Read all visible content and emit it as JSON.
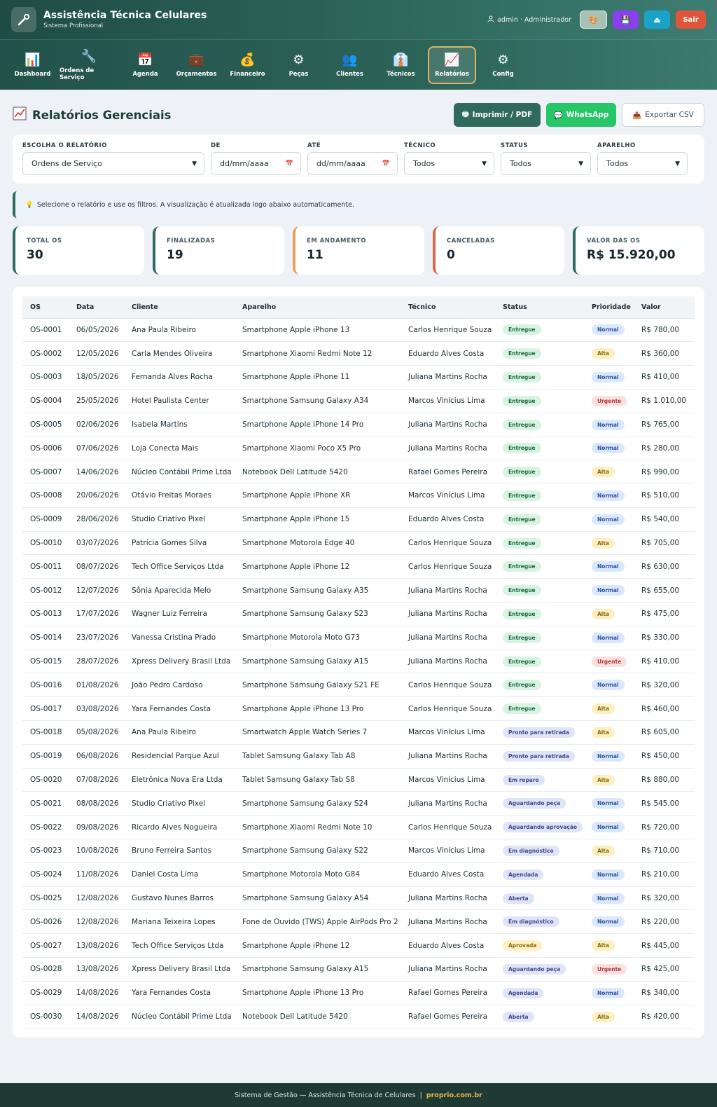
{
  "header": {
    "title": "Assistência Técnica Celulares",
    "subtitle": "Sistema Profissional",
    "user": "admin · Administrador",
    "logout_label": "Sair"
  },
  "nav": [
    {
      "label": "Dashboard",
      "icon": "bar-chart-icon",
      "glyph": "📊"
    },
    {
      "label": "Ordens de Serviço",
      "icon": "wrench-icon",
      "glyph": "🔧"
    },
    {
      "label": "Agenda",
      "icon": "calendar-icon",
      "glyph": "📅"
    },
    {
      "label": "Orçamentos",
      "icon": "briefcase-icon",
      "glyph": "💼"
    },
    {
      "label": "Financeiro",
      "icon": "money-bag-icon",
      "glyph": "💰"
    },
    {
      "label": "Peças",
      "icon": "gear-icon",
      "glyph": "⚙"
    },
    {
      "label": "Clientes",
      "icon": "users-icon",
      "glyph": "👥"
    },
    {
      "label": "Técnicos",
      "icon": "technician-icon",
      "glyph": "👔"
    },
    {
      "label": "Relatórios",
      "icon": "chart-up-icon",
      "glyph": "📈"
    },
    {
      "label": "Config",
      "icon": "settings-icon",
      "glyph": "⚙"
    }
  ],
  "page": {
    "title": "Relatórios Gerenciais",
    "print_label": "Imprimir / PDF",
    "whatsapp_label": "WhatsApp",
    "csv_label": "Exportar CSV"
  },
  "filters": {
    "report_label": "ESCOLHA O RELATÓRIO",
    "report_value": "Ordens de Serviço",
    "from_label": "DE",
    "from_value": "dd/mm/aaaa",
    "to_label": "ATÉ",
    "to_value": "dd/mm/aaaa",
    "tech_label": "TÉCNICO",
    "tech_value": "Todos",
    "status_label": "STATUS",
    "status_value": "Todos",
    "device_label": "APARELHO",
    "device_value": "Todos"
  },
  "hint": "Selecione o relatório e use os filtros. A visualização é atualizada logo abaixo automaticamente.",
  "stats": [
    {
      "label": "TOTAL OS",
      "value": "30"
    },
    {
      "label": "FINALIZADAS",
      "value": "19"
    },
    {
      "label": "EM ANDAMENTO",
      "value": "11"
    },
    {
      "label": "CANCELADAS",
      "value": "0"
    },
    {
      "label": "VALOR DAS OS",
      "value": "R$ 15.920,00"
    }
  ],
  "table": {
    "headers": [
      "OS",
      "Data",
      "Cliente",
      "Aparelho",
      "Técnico",
      "Status",
      "Prioridade",
      "Valor"
    ],
    "rows": [
      [
        "OS-0001",
        "06/05/2026",
        "Ana Paula Ribeiro",
        "Smartphone Apple iPhone 13",
        "Carlos Henrique Souza",
        "Entregue",
        "Normal",
        "R$ 780,00"
      ],
      [
        "OS-0002",
        "12/05/2026",
        "Carla Mendes Oliveira",
        "Smartphone Xiaomi Redmi Note 12",
        "Eduardo Alves Costa",
        "Entregue",
        "Alta",
        "R$ 360,00"
      ],
      [
        "OS-0003",
        "18/05/2026",
        "Fernanda Alves Rocha",
        "Smartphone Apple iPhone 11",
        "Juliana Martins Rocha",
        "Entregue",
        "Normal",
        "R$ 410,00"
      ],
      [
        "OS-0004",
        "25/05/2026",
        "Hotel Paulista Center",
        "Smartphone Samsung Galaxy A34",
        "Marcos Vinícius Lima",
        "Entregue",
        "Urgente",
        "R$ 1.010,00"
      ],
      [
        "OS-0005",
        "02/06/2026",
        "Isabela Martins",
        "Smartphone Apple iPhone 14 Pro",
        "Juliana Martins Rocha",
        "Entregue",
        "Normal",
        "R$ 765,00"
      ],
      [
        "OS-0006",
        "07/06/2026",
        "Loja Conecta Mais",
        "Smartphone Xiaomi Poco X5 Pro",
        "Juliana Martins Rocha",
        "Entregue",
        "Normal",
        "R$ 280,00"
      ],
      [
        "OS-0007",
        "14/06/2026",
        "Núcleo Contábil Prime Ltda",
        "Notebook Dell Latitude 5420",
        "Rafael Gomes Pereira",
        "Entregue",
        "Alta",
        "R$ 990,00"
      ],
      [
        "OS-0008",
        "20/06/2026",
        "Otávio Freitas Moraes",
        "Smartphone Apple iPhone XR",
        "Marcos Vinícius Lima",
        "Entregue",
        "Normal",
        "R$ 510,00"
      ],
      [
        "OS-0009",
        "28/06/2026",
        "Studio Criativo Pixel",
        "Smartphone Apple iPhone 15",
        "Eduardo Alves Costa",
        "Entregue",
        "Normal",
        "R$ 540,00"
      ],
      [
        "OS-0010",
        "03/07/2026",
        "Patrícia Gomes Silva",
        "Smartphone Motorola Edge 40",
        "Carlos Henrique Souza",
        "Entregue",
        "Alta",
        "R$ 705,00"
      ],
      [
        "OS-0011",
        "08/07/2026",
        "Tech Office Serviços Ltda",
        "Smartphone Apple iPhone 12",
        "Carlos Henrique Souza",
        "Entregue",
        "Normal",
        "R$ 630,00"
      ],
      [
        "OS-0012",
        "12/07/2026",
        "Sônia Aparecida Melo",
        "Smartphone Samsung Galaxy A35",
        "Juliana Martins Rocha",
        "Entregue",
        "Normal",
        "R$ 655,00"
      ],
      [
        "OS-0013",
        "17/07/2026",
        "Wagner Luiz Ferreira",
        "Smartphone Samsung Galaxy S23",
        "Juliana Martins Rocha",
        "Entregue",
        "Alta",
        "R$ 475,00"
      ],
      [
        "OS-0014",
        "23/07/2026",
        "Vanessa Cristina Prado",
        "Smartphone Motorola Moto G73",
        "Juliana Martins Rocha",
        "Entregue",
        "Normal",
        "R$ 330,00"
      ],
      [
        "OS-0015",
        "28/07/2026",
        "Xpress Delivery Brasil Ltda",
        "Smartphone Samsung Galaxy A15",
        "Juliana Martins Rocha",
        "Entregue",
        "Urgente",
        "R$ 410,00"
      ],
      [
        "OS-0016",
        "01/08/2026",
        "João Pedro Cardoso",
        "Smartphone Samsung Galaxy S21 FE",
        "Carlos Henrique Souza",
        "Entregue",
        "Normal",
        "R$ 320,00"
      ],
      [
        "OS-0017",
        "03/08/2026",
        "Yara Fernandes Costa",
        "Smartphone Apple iPhone 13 Pro",
        "Carlos Henrique Souza",
        "Entregue",
        "Alta",
        "R$ 460,00"
      ],
      [
        "OS-0018",
        "05/08/2026",
        "Ana Paula Ribeiro",
        "Smartwatch Apple Watch Series 7",
        "Marcos Vinícius Lima",
        "Pronto para retirada",
        "Alta",
        "R$ 605,00"
      ],
      [
        "OS-0019",
        "06/08/2026",
        "Residencial Parque Azul",
        "Tablet Samsung Galaxy Tab A8",
        "Juliana Martins Rocha",
        "Pronto para retirada",
        "Normal",
        "R$ 450,00"
      ],
      [
        "OS-0020",
        "07/08/2026",
        "Eletrônica Nova Era Ltda",
        "Tablet Samsung Galaxy Tab S8",
        "Marcos Vinícius Lima",
        "Em reparo",
        "Alta",
        "R$ 880,00"
      ],
      [
        "OS-0021",
        "08/08/2026",
        "Studio Criativo Pixel",
        "Smartphone Samsung Galaxy S24",
        "Juliana Martins Rocha",
        "Aguardando peça",
        "Normal",
        "R$ 545,00"
      ],
      [
        "OS-0022",
        "09/08/2026",
        "Ricardo Alves Nogueira",
        "Smartphone Xiaomi Redmi Note 10",
        "Carlos Henrique Souza",
        "Aguardando aprovação",
        "Normal",
        "R$ 720,00"
      ],
      [
        "OS-0023",
        "10/08/2026",
        "Bruno Ferreira Santos",
        "Smartphone Samsung Galaxy S22",
        "Marcos Vinícius Lima",
        "Em diagnóstico",
        "Alta",
        "R$ 710,00"
      ],
      [
        "OS-0024",
        "11/08/2026",
        "Daniel Costa Lima",
        "Smartphone Motorola Moto G84",
        "Eduardo Alves Costa",
        "Agendada",
        "Normal",
        "R$ 210,00"
      ],
      [
        "OS-0025",
        "12/08/2026",
        "Gustavo Nunes Barros",
        "Smartphone Samsung Galaxy A54",
        "Juliana Martins Rocha",
        "Aberta",
        "Normal",
        "R$ 320,00"
      ],
      [
        "OS-0026",
        "12/08/2026",
        "Mariana Teixeira Lopes",
        "Fone de Ouvido (TWS) Apple AirPods Pro 2",
        "Juliana Martins Rocha",
        "Em diagnóstico",
        "Normal",
        "R$ 220,00"
      ],
      [
        "OS-0027",
        "13/08/2026",
        "Tech Office Serviços Ltda",
        "Smartphone Apple iPhone 12",
        "Eduardo Alves Costa",
        "Aprovada",
        "Alta",
        "R$ 445,00"
      ],
      [
        "OS-0028",
        "13/08/2026",
        "Xpress Delivery Brasil Ltda",
        "Smartphone Samsung Galaxy A15",
        "Juliana Martins Rocha",
        "Aguardando peça",
        "Urgente",
        "R$ 425,00"
      ],
      [
        "OS-0029",
        "14/08/2026",
        "Yara Fernandes Costa",
        "Smartphone Apple iPhone 13 Pro",
        "Rafael Gomes Pereira",
        "Agendada",
        "Normal",
        "R$ 340,00"
      ],
      [
        "OS-0030",
        "14/08/2026",
        "Núcleo Contábil Prime Ltda",
        "Notebook Dell Latitude 5420",
        "Rafael Gomes Pereira",
        "Aberta",
        "Alta",
        "R$ 420,00"
      ]
    ]
  },
  "footer": {
    "text": "Sistema de Gestão — Assistência Técnica de Celulares",
    "separator": "|",
    "link": "proprio.com.br"
  },
  "colors": {
    "primary": "#2f6a5d",
    "accent": "#d9b56a",
    "whatsapp": "#27c668",
    "danger": "#e0553a"
  }
}
